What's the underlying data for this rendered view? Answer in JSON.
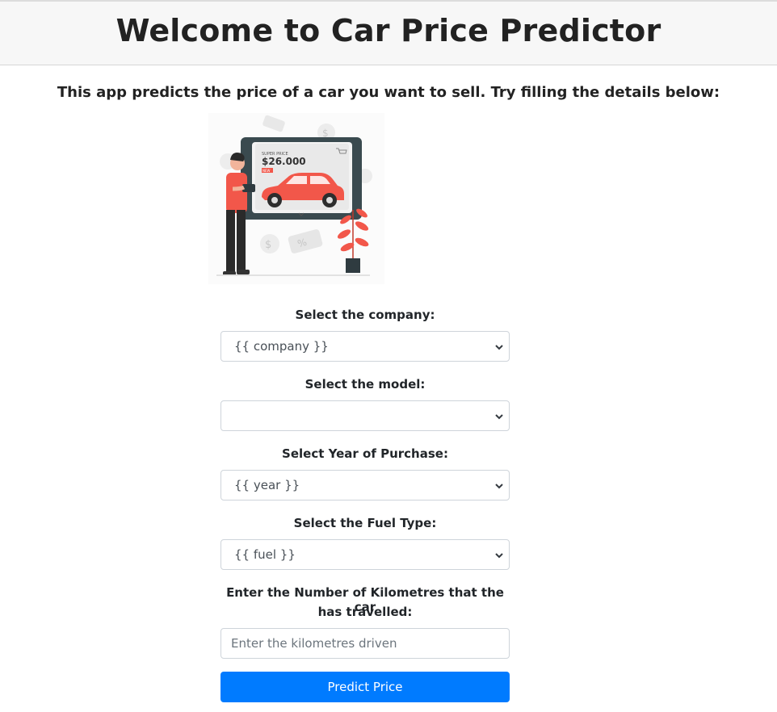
{
  "header": {
    "title": "Welcome to Car Price Predictor"
  },
  "intro": {
    "text": "This app predicts the price of a car you want to sell. Try filling the details below:"
  },
  "illustration": {
    "price_caption": "SUPER PRICE",
    "price_value": "$26.000",
    "badge": "NEW"
  },
  "form": {
    "company_label": "Select the company:",
    "company_value": "{{ company }}",
    "model_label": "Select the model:",
    "model_value": "",
    "year_label": "Select Year of Purchase:",
    "year_value": "{{ year }}",
    "fuel_label": "Select the Fuel Type:",
    "fuel_value": "{{ fuel }}",
    "km_label_line1": "Enter the Number of Kilometres that the car",
    "km_label_line2": "has travelled:",
    "km_placeholder": "Enter the kilometres driven",
    "submit_label": "Predict Price"
  },
  "colors": {
    "accent": "#007bff",
    "car": "#f2574a"
  }
}
